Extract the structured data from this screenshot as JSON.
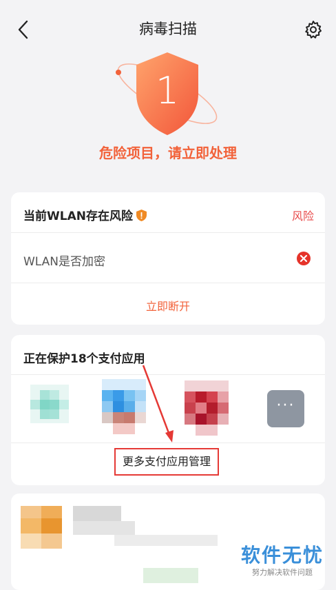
{
  "header": {
    "title": "病毒扫描",
    "back_icon": "back-arrow-icon",
    "settings_icon": "gear-icon"
  },
  "hero": {
    "count": "1",
    "status": "危险项目，请立即处理"
  },
  "wlan_card": {
    "title": "当前WLAN存在风险",
    "risk_label": "风险",
    "item_label": "WLAN是否加密",
    "action_label": "立即断开"
  },
  "pay_card": {
    "title": "正在保护18个支付应用",
    "more_label": "···",
    "manage_label": "更多支付应用管理"
  },
  "watermark": {
    "line1": "软件无忧",
    "line2": "努力解决软件问题"
  },
  "colors": {
    "accent": "#f2623a",
    "risk": "#e84a4a",
    "background": "#f3f3f5"
  }
}
